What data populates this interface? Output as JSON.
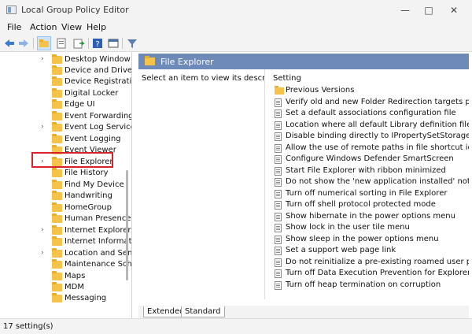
{
  "window": {
    "title": "Local Group Policy Editor"
  },
  "menu": [
    "File",
    "Action",
    "View",
    "Help"
  ],
  "tree": {
    "items": [
      {
        "label": "Desktop Window",
        "chevron": true
      },
      {
        "label": "Device and Driver",
        "chevron": false
      },
      {
        "label": "Device Registratio",
        "chevron": false
      },
      {
        "label": "Digital Locker",
        "chevron": false
      },
      {
        "label": "Edge UI",
        "chevron": false
      },
      {
        "label": "Event Forwarding",
        "chevron": false
      },
      {
        "label": "Event Log Service",
        "chevron": true
      },
      {
        "label": "Event Logging",
        "chevron": false
      },
      {
        "label": "Event Viewer",
        "chevron": false
      },
      {
        "label": "File Explorer",
        "chevron": true
      },
      {
        "label": "File History",
        "chevron": false
      },
      {
        "label": "Find My Device",
        "chevron": false
      },
      {
        "label": "Handwriting",
        "chevron": false
      },
      {
        "label": "HomeGroup",
        "chevron": false
      },
      {
        "label": "Human Presence",
        "chevron": false
      },
      {
        "label": "Internet Explorer",
        "chevron": true
      },
      {
        "label": "Internet Informati",
        "chevron": false
      },
      {
        "label": "Location and Sens",
        "chevron": true
      },
      {
        "label": "Maintenance Sche",
        "chevron": false
      },
      {
        "label": "Maps",
        "chevron": false
      },
      {
        "label": "MDM",
        "chevron": false
      },
      {
        "label": "Messaging",
        "chevron": false
      }
    ]
  },
  "pane": {
    "title": "File Explorer",
    "description": "Select an item to view its description.",
    "column_header": "Setting",
    "rows": [
      {
        "label": "Previous Versions",
        "type": "folder"
      },
      {
        "label": "Verify old and new Folder Redirection targets point to",
        "type": "setting"
      },
      {
        "label": "Set a default associations configuration file",
        "type": "setting"
      },
      {
        "label": "Location where all default Library definition files for u",
        "type": "setting"
      },
      {
        "label": "Disable binding directly to IPropertySetStorage withou",
        "type": "setting"
      },
      {
        "label": "Allow the use of remote paths in file shortcut icons",
        "type": "setting"
      },
      {
        "label": "Configure Windows Defender SmartScreen",
        "type": "setting"
      },
      {
        "label": "Start File Explorer with ribbon minimized",
        "type": "setting"
      },
      {
        "label": "Do not show the 'new application installed' notificati",
        "type": "setting"
      },
      {
        "label": "Turn off numerical sorting in File Explorer",
        "type": "setting"
      },
      {
        "label": "Turn off shell protocol protected mode",
        "type": "setting"
      },
      {
        "label": "Show hibernate in the power options menu",
        "type": "setting"
      },
      {
        "label": "Show lock in the user tile menu",
        "type": "setting"
      },
      {
        "label": "Show sleep in the power options menu",
        "type": "setting"
      },
      {
        "label": "Set a support web page link",
        "type": "setting"
      },
      {
        "label": "Do not reinitialize a pre-existing roamed user profile v",
        "type": "setting"
      },
      {
        "label": "Turn off Data Execution Prevention for Explorer",
        "type": "setting"
      },
      {
        "label": "Turn off heap termination on corruption",
        "type": "setting"
      }
    ]
  },
  "tabs": [
    "Extended",
    "Standard"
  ],
  "status": {
    "text": "17 setting(s)"
  },
  "colors": {
    "pane_header": "#6e8ab8",
    "highlight": "#d6222a",
    "folder": "#f6c34a"
  }
}
